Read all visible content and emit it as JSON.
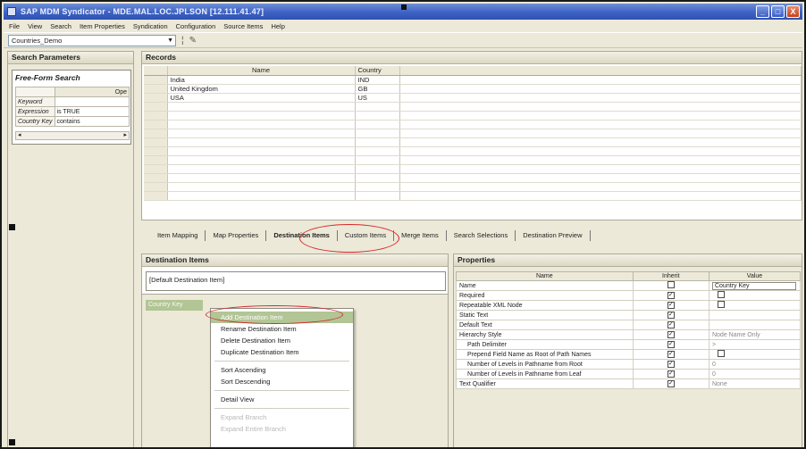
{
  "window": {
    "title": "SAP MDM Syndicator - MDE.MAL.LOC.JPLSON [12.111.41.47]",
    "controls": [
      "_",
      "□",
      "X"
    ]
  },
  "menu": [
    "File",
    "View",
    "Search",
    "Item Properties",
    "Syndication",
    "Configuration",
    "Source Items",
    "Help"
  ],
  "toolbar": {
    "map_combo_value": "Countries_Demo"
  },
  "search_parameters": {
    "header": "Search Parameters",
    "free_form_title": "Free-Form Search",
    "op_header": "Ope",
    "rows": [
      {
        "label": "Keyword",
        "value": ""
      },
      {
        "label": "Expression",
        "value": "is TRUE"
      },
      {
        "label": "Country Key",
        "value": "contains"
      }
    ]
  },
  "records": {
    "header": "Records",
    "columns": [
      "Name",
      "Country"
    ],
    "rows": [
      {
        "name": "India",
        "country": "IND"
      },
      {
        "name": "United Kingdom",
        "country": "GB"
      },
      {
        "name": "USA",
        "country": "US"
      }
    ]
  },
  "tabs": [
    "Item Mapping",
    "Map Properties",
    "Destination Items",
    "Custom Items",
    "Merge Items",
    "Search Selections",
    "Destination Preview"
  ],
  "active_tab": "Destination Items",
  "destination_items": {
    "header": "Destination Items",
    "default_item": "[Default Destination Item]",
    "node": "Country Key"
  },
  "context_menu": {
    "items": [
      {
        "label": "Add Destination Item",
        "state": "highlighted"
      },
      {
        "label": "Rename Destination Item",
        "state": "normal"
      },
      {
        "label": "Delete Destination Item",
        "state": "normal"
      },
      {
        "label": "Duplicate Destination Item",
        "state": "normal"
      },
      {
        "label": "Sort Ascending",
        "state": "normal"
      },
      {
        "label": "Sort Descending",
        "state": "normal"
      },
      {
        "label": "Detail View",
        "state": "normal"
      },
      {
        "label": "Expand Branch",
        "state": "disabled"
      },
      {
        "label": "Expand Entire Branch",
        "state": "disabled"
      }
    ]
  },
  "properties": {
    "header": "Properties",
    "columns": [
      "Name",
      "Inherit",
      "Value"
    ],
    "rows": [
      {
        "name": "Name",
        "inherit": false,
        "value": "Country Key",
        "value_type": "input"
      },
      {
        "name": "Required",
        "inherit": true,
        "value": "",
        "value_type": "checkbox"
      },
      {
        "name": "Repeatable XML Node",
        "inherit": true,
        "value": "",
        "value_type": "checkbox"
      },
      {
        "name": "Static Text",
        "inherit": true,
        "value": ""
      },
      {
        "name": "Default Text",
        "inherit": true,
        "value": ""
      },
      {
        "name": "Hierarchy Style",
        "inherit": true,
        "value": "Node Name Only"
      },
      {
        "name": "Path Delimiter",
        "inherit": true,
        "value": ">",
        "indent": true
      },
      {
        "name": "Prepend Field Name as Root of Path Names",
        "inherit": true,
        "value": "",
        "value_type": "checkbox",
        "indent": true
      },
      {
        "name": "Number of Levels in Pathname from Root",
        "inherit": true,
        "value": "0",
        "indent": true
      },
      {
        "name": "Number of Levels in Pathname from Leaf",
        "inherit": true,
        "value": "0",
        "indent": true
      },
      {
        "name": "Text Qualifier",
        "inherit": true,
        "value": "None"
      }
    ]
  }
}
